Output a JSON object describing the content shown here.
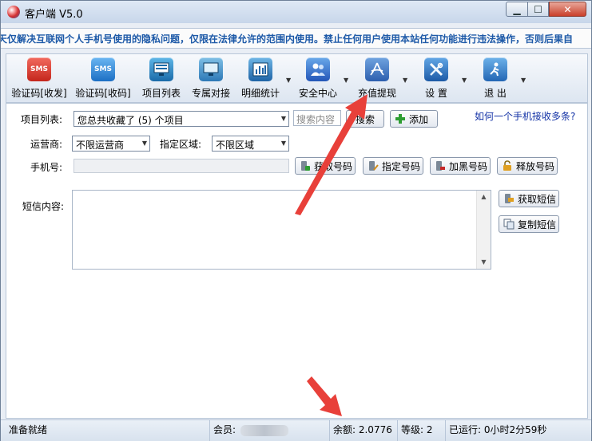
{
  "window": {
    "title": "客户端 V5.0",
    "minimize_label": "▁",
    "maximize_label": "☐",
    "close_label": "✕"
  },
  "marquee": "天仅解决互联网个人手机号使用的隐私问题，仅限在法律允许的范围内使用。禁止任何用户使用本站任何功能进行违法操作，否则后果自",
  "toolbar": {
    "items": [
      {
        "label": "验证码[收发]",
        "icon": "sms-icon",
        "badge": "SMS"
      },
      {
        "label": "验证码[收码]",
        "icon": "sms-icon",
        "badge": "SMS"
      },
      {
        "label": "项目列表",
        "icon": "monitor-list-icon"
      },
      {
        "label": "专属对接",
        "icon": "monitor-icon"
      },
      {
        "label": "明细统计",
        "icon": "bar-chart-icon"
      },
      {
        "label": "安全中心",
        "icon": "users-icon"
      },
      {
        "label": "充值提现",
        "icon": "acrobat-icon"
      },
      {
        "label": "设 置",
        "icon": "tools-icon"
      },
      {
        "label": "退 出",
        "icon": "run-icon"
      }
    ]
  },
  "form": {
    "project_label": "项目列表:",
    "project_select": "您总共收藏了 (5) 个项目",
    "search_placeholder": "搜索内容",
    "search_button": "搜索",
    "add_button": "添加",
    "help_link": "如何一个手机接收多条?",
    "carrier_label": "运营商:",
    "carrier_select": "不限运营商",
    "region_label": "指定区域:",
    "region_select": "不限区域",
    "phone_label": "手机号:",
    "get_number": "获取号码",
    "assign_number": "指定号码",
    "blacklist_number": "加黑号码",
    "release_number": "释放号码",
    "sms_label": "短信内容:",
    "get_sms": "获取短信",
    "copy_sms": "复制短信"
  },
  "status": {
    "ready": "准备就绪",
    "member_label": "会员:",
    "balance": "余额: 2.0776",
    "level": "等级: 2",
    "uptime": "已运行: 0小时2分59秒"
  },
  "colors": {
    "annotation_arrow": "#e8403a",
    "link": "#1433a6",
    "marquee_text": "#1e5aa8"
  }
}
